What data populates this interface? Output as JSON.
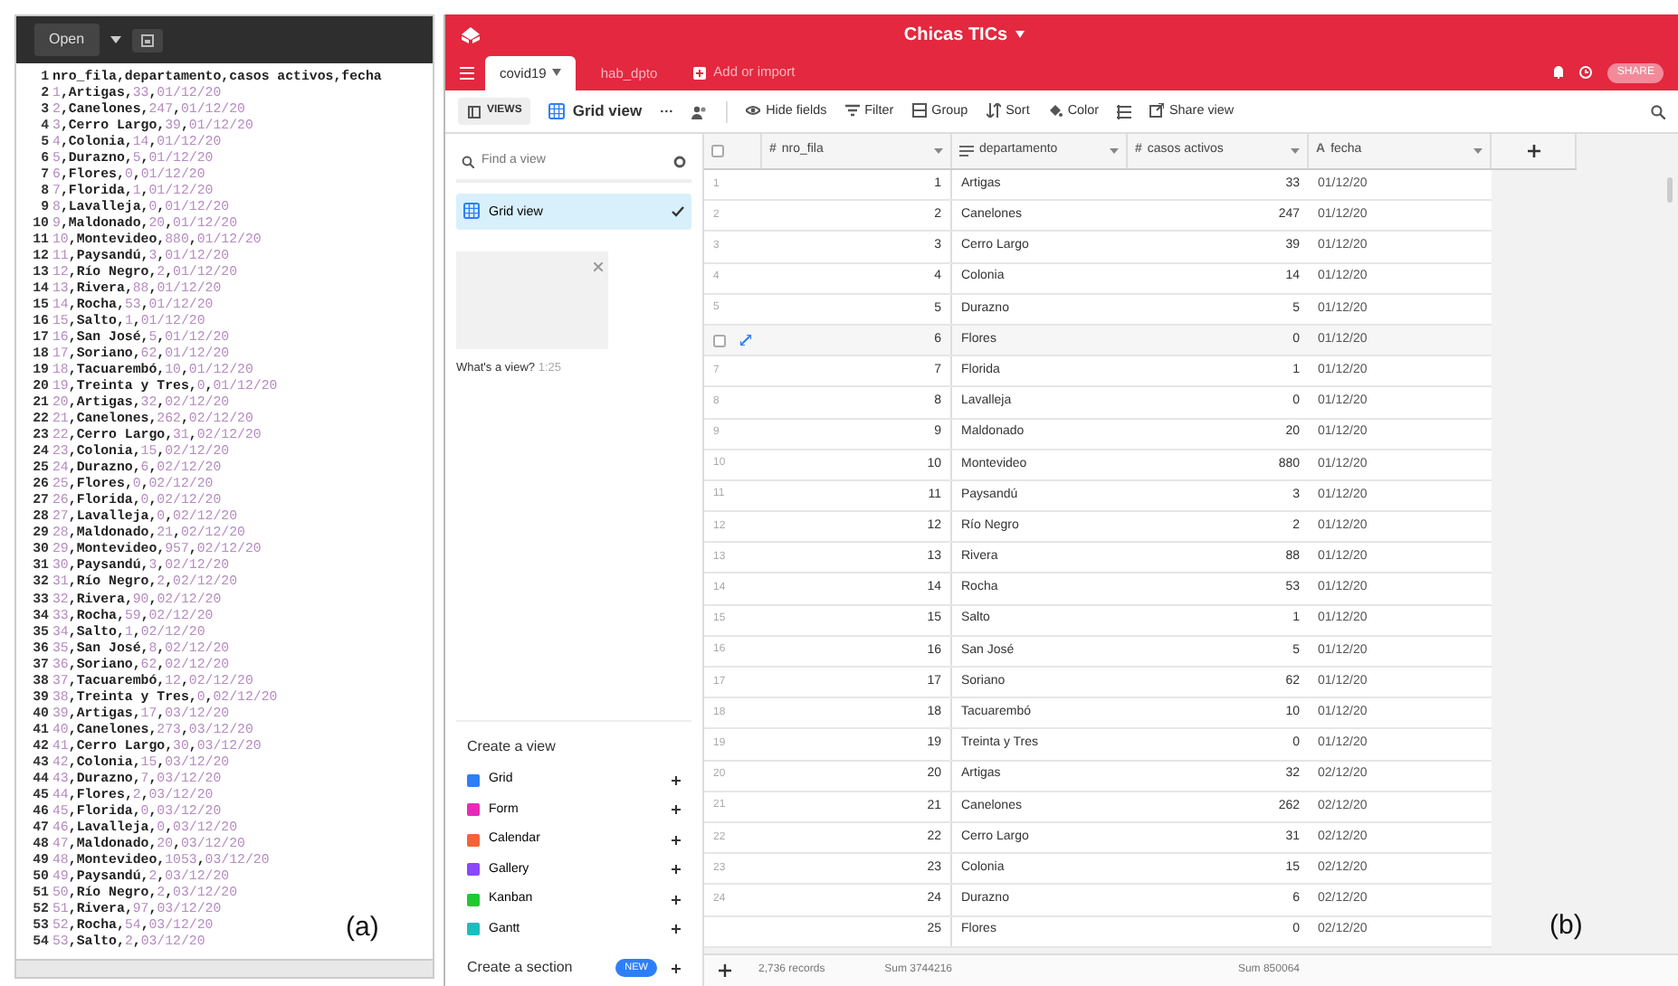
{
  "panel_a": {
    "open_button": "Open",
    "caption": "(a)",
    "lines": [
      {
        "number": "1",
        "kind": "header",
        "text": "nro_fila,departamento,casos activos,fecha"
      },
      {
        "number": "2",
        "kind": "data",
        "text": "1,Artigas,33,01/12/20"
      },
      {
        "number": "3",
        "kind": "data",
        "text": "2,Canelones,247,01/12/20"
      },
      {
        "number": "4",
        "kind": "data",
        "text": "3,Cerro Largo,39,01/12/20"
      },
      {
        "number": "5",
        "kind": "data",
        "text": "4,Colonia,14,01/12/20"
      },
      {
        "number": "6",
        "kind": "data",
        "text": "5,Durazno,5,01/12/20"
      },
      {
        "number": "7",
        "kind": "data",
        "text": "6,Flores,0,01/12/20"
      },
      {
        "number": "8",
        "kind": "data",
        "text": "7,Florida,1,01/12/20"
      },
      {
        "number": "9",
        "kind": "data",
        "text": "8,Lavalleja,0,01/12/20"
      },
      {
        "number": "10",
        "kind": "data",
        "text": "9,Maldonado,20,01/12/20"
      },
      {
        "number": "11",
        "kind": "data",
        "text": "10,Montevideo,880,01/12/20"
      },
      {
        "number": "12",
        "kind": "data",
        "text": "11,Paysandú,3,01/12/20"
      },
      {
        "number": "13",
        "kind": "data",
        "text": "12,Río Negro,2,01/12/20"
      },
      {
        "number": "14",
        "kind": "data",
        "text": "13,Rivera,88,01/12/20"
      },
      {
        "number": "15",
        "kind": "data",
        "text": "14,Rocha,53,01/12/20"
      },
      {
        "number": "16",
        "kind": "data",
        "text": "15,Salto,1,01/12/20"
      },
      {
        "number": "17",
        "kind": "data",
        "text": "16,San José,5,01/12/20"
      },
      {
        "number": "18",
        "kind": "data",
        "text": "17,Soriano,62,01/12/20"
      },
      {
        "number": "19",
        "kind": "data",
        "text": "18,Tacuarembó,10,01/12/20"
      },
      {
        "number": "20",
        "kind": "data",
        "text": "19,Treinta y Tres,0,01/12/20"
      },
      {
        "number": "21",
        "kind": "data",
        "text": "20,Artigas,32,02/12/20"
      },
      {
        "number": "22",
        "kind": "data",
        "text": "21,Canelones,262,02/12/20"
      },
      {
        "number": "23",
        "kind": "data",
        "text": "22,Cerro Largo,31,02/12/20"
      },
      {
        "number": "24",
        "kind": "data",
        "text": "23,Colonia,15,02/12/20"
      },
      {
        "number": "25",
        "kind": "data",
        "text": "24,Durazno,6,02/12/20"
      },
      {
        "number": "26",
        "kind": "data",
        "text": "25,Flores,0,02/12/20"
      },
      {
        "number": "27",
        "kind": "data",
        "text": "26,Florida,0,02/12/20"
      },
      {
        "number": "28",
        "kind": "data",
        "text": "27,Lavalleja,0,02/12/20"
      },
      {
        "number": "29",
        "kind": "data",
        "text": "28,Maldonado,21,02/12/20"
      },
      {
        "number": "30",
        "kind": "data",
        "text": "29,Montevideo,957,02/12/20"
      },
      {
        "number": "31",
        "kind": "data",
        "text": "30,Paysandú,3,02/12/20"
      },
      {
        "number": "32",
        "kind": "data",
        "text": "31,Río Negro,2,02/12/20"
      },
      {
        "number": "33",
        "kind": "data",
        "text": "32,Rivera,90,02/12/20"
      },
      {
        "number": "34",
        "kind": "data",
        "text": "33,Rocha,59,02/12/20"
      },
      {
        "number": "35",
        "kind": "data",
        "text": "34,Salto,1,02/12/20"
      },
      {
        "number": "36",
        "kind": "data",
        "text": "35,San José,8,02/12/20"
      },
      {
        "number": "37",
        "kind": "data",
        "text": "36,Soriano,62,02/12/20"
      },
      {
        "number": "38",
        "kind": "data",
        "text": "37,Tacuarembó,12,02/12/20"
      },
      {
        "number": "39",
        "kind": "data",
        "text": "38,Treinta y Tres,0,02/12/20"
      },
      {
        "number": "40",
        "kind": "data",
        "text": "39,Artigas,17,03/12/20"
      },
      {
        "number": "41",
        "kind": "data",
        "text": "40,Canelones,273,03/12/20"
      },
      {
        "number": "42",
        "kind": "data",
        "text": "41,Cerro Largo,30,03/12/20"
      },
      {
        "number": "43",
        "kind": "data",
        "text": "42,Colonia,15,03/12/20"
      },
      {
        "number": "44",
        "kind": "data",
        "text": "43,Durazno,7,03/12/20"
      },
      {
        "number": "45",
        "kind": "data",
        "text": "44,Flores,2,03/12/20"
      },
      {
        "number": "46",
        "kind": "data",
        "text": "45,Florida,0,03/12/20"
      },
      {
        "number": "47",
        "kind": "data",
        "text": "46,Lavalleja,0,03/12/20"
      },
      {
        "number": "48",
        "kind": "data",
        "text": "47,Maldonado,20,03/12/20"
      },
      {
        "number": "49",
        "kind": "data",
        "text": "48,Montevideo,1053,03/12/20"
      },
      {
        "number": "50",
        "kind": "data",
        "text": "49,Paysandú,2,03/12/20"
      },
      {
        "number": "51",
        "kind": "data",
        "text": "50,Río Negro,2,03/12/20"
      },
      {
        "number": "52",
        "kind": "data",
        "text": "51,Rivera,97,03/12/20"
      },
      {
        "number": "53",
        "kind": "data",
        "text": "52,Rocha,54,03/12/20"
      },
      {
        "number": "54",
        "kind": "data",
        "text": "53,Salto,2,03/12/20"
      }
    ]
  },
  "panel_b": {
    "base_title": "Chicas TICs",
    "share_button": "SHARE",
    "caption": "(b)",
    "tabs": [
      {
        "label": "covid19",
        "selected": true
      },
      {
        "label": "hab_dpto",
        "selected": false
      }
    ],
    "add_import": "Add or import",
    "toolbar": {
      "views": "VIEWS",
      "view_name": "Grid view",
      "more": "···",
      "hide_fields": "Hide fields",
      "filter": "Filter",
      "group": "Group",
      "sort": "Sort",
      "color_label": "Color",
      "share_view": "Share view"
    },
    "sidebar": {
      "search": {
        "placeholder": "Find a view"
      },
      "views": [
        {
          "label": "Grid view",
          "selected": true
        }
      ],
      "promo": {
        "title": "What's a view?",
        "duration": "1:25"
      },
      "create_heading": "Create a view",
      "create_items": [
        {
          "label": "Grid",
          "color": "#2d7ff9"
        },
        {
          "label": "Form",
          "color": "#e929ba"
        },
        {
          "label": "Calendar",
          "color": "#f4623a"
        },
        {
          "label": "Gallery",
          "color": "#8b46ff"
        },
        {
          "label": "Kanban",
          "color": "#20c933"
        },
        {
          "label": "Gantt",
          "color": "#18bfbf"
        }
      ],
      "create_section": "Create a section",
      "new_badge": "NEW"
    },
    "table": {
      "select_all_checked": false,
      "columns": [
        {
          "label": "nro_fila",
          "kind": "number",
          "type_glyph": "#"
        },
        {
          "label": "departamento",
          "kind": "long_text"
        },
        {
          "label": "casos activos",
          "kind": "number",
          "type_glyph": "#"
        },
        {
          "label": "fecha",
          "kind": "text",
          "type_glyph": "A"
        }
      ],
      "rows": [
        {
          "number": "1",
          "cells": [
            "1",
            "Artigas",
            "33",
            "01/12/20"
          ],
          "hovered": false
        },
        {
          "number": "2",
          "cells": [
            "2",
            "Canelones",
            "247",
            "01/12/20"
          ],
          "hovered": false
        },
        {
          "number": "3",
          "cells": [
            "3",
            "Cerro Largo",
            "39",
            "01/12/20"
          ],
          "hovered": false
        },
        {
          "number": "4",
          "cells": [
            "4",
            "Colonia",
            "14",
            "01/12/20"
          ],
          "hovered": false
        },
        {
          "number": "5",
          "cells": [
            "5",
            "Durazno",
            "5",
            "01/12/20"
          ],
          "hovered": false
        },
        {
          "cells": [
            "6",
            "Flores",
            "0",
            "01/12/20"
          ],
          "hovered": true,
          "checked": false
        },
        {
          "number": "7",
          "cells": [
            "7",
            "Florida",
            "1",
            "01/12/20"
          ],
          "hovered": false
        },
        {
          "number": "8",
          "cells": [
            "8",
            "Lavalleja",
            "0",
            "01/12/20"
          ],
          "hovered": false
        },
        {
          "number": "9",
          "cells": [
            "9",
            "Maldonado",
            "20",
            "01/12/20"
          ],
          "hovered": false
        },
        {
          "number": "10",
          "cells": [
            "10",
            "Montevideo",
            "880",
            "01/12/20"
          ],
          "hovered": false
        },
        {
          "number": "11",
          "cells": [
            "11",
            "Paysandú",
            "3",
            "01/12/20"
          ],
          "hovered": false
        },
        {
          "number": "12",
          "cells": [
            "12",
            "Río Negro",
            "2",
            "01/12/20"
          ],
          "hovered": false
        },
        {
          "number": "13",
          "cells": [
            "13",
            "Rivera",
            "88",
            "01/12/20"
          ],
          "hovered": false
        },
        {
          "number": "14",
          "cells": [
            "14",
            "Rocha",
            "53",
            "01/12/20"
          ],
          "hovered": false
        },
        {
          "number": "15",
          "cells": [
            "15",
            "Salto",
            "1",
            "01/12/20"
          ],
          "hovered": false
        },
        {
          "number": "16",
          "cells": [
            "16",
            "San José",
            "5",
            "01/12/20"
          ],
          "hovered": false
        },
        {
          "number": "17",
          "cells": [
            "17",
            "Soriano",
            "62",
            "01/12/20"
          ],
          "hovered": false
        },
        {
          "number": "18",
          "cells": [
            "18",
            "Tacuarembó",
            "10",
            "01/12/20"
          ],
          "hovered": false
        },
        {
          "number": "19",
          "cells": [
            "19",
            "Treinta y Tres",
            "0",
            "01/12/20"
          ],
          "hovered": false
        },
        {
          "number": "20",
          "cells": [
            "20",
            "Artigas",
            "32",
            "02/12/20"
          ],
          "hovered": false
        },
        {
          "number": "21",
          "cells": [
            "21",
            "Canelones",
            "262",
            "02/12/20"
          ],
          "hovered": false
        },
        {
          "number": "22",
          "cells": [
            "22",
            "Cerro Largo",
            "31",
            "02/12/20"
          ],
          "hovered": false
        },
        {
          "number": "23",
          "cells": [
            "23",
            "Colonia",
            "15",
            "02/12/20"
          ],
          "hovered": false
        },
        {
          "number": "24",
          "cells": [
            "24",
            "Durazno",
            "6",
            "02/12/20"
          ],
          "hovered": false
        },
        {
          "cells": [
            "25",
            "Flores",
            "0",
            "02/12/20"
          ],
          "hovered": false
        }
      ],
      "footer": {
        "records": "2,736 records",
        "sum_nro_fila": "Sum 3744216",
        "sum_casos": "Sum 850064"
      }
    }
  }
}
